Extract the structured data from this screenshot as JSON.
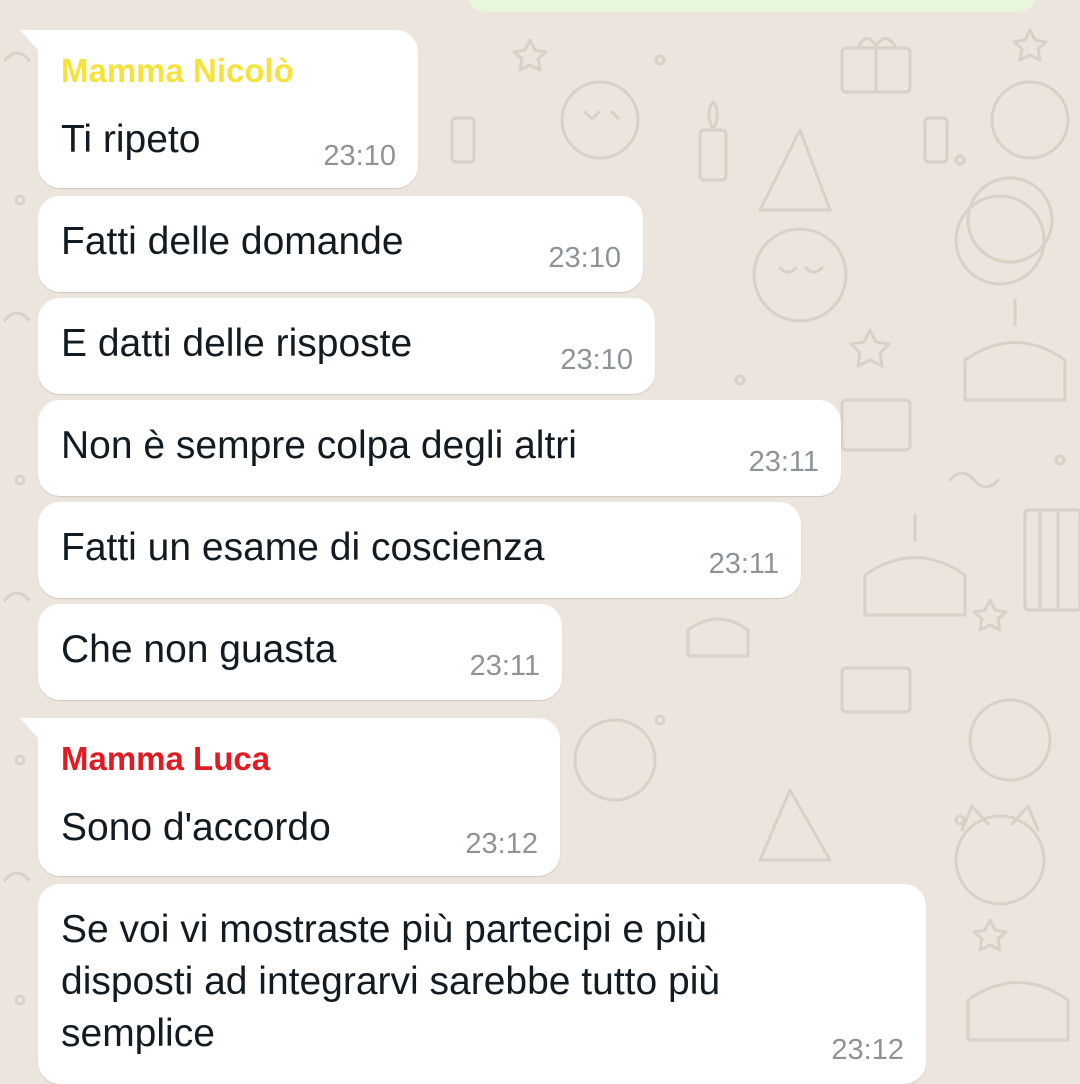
{
  "colors": {
    "background": "#ece5dd",
    "bubble_incoming": "#ffffff",
    "bubble_outgoing": "#e7f7dc",
    "sender_mamma_nicolo": "#f5e23c",
    "sender_mamma_luca": "#e11b22",
    "text": "#111b21",
    "timestamp": "#8c9499"
  },
  "messages": [
    {
      "sender": "Mamma Nicolò",
      "text": "Ti ripeto",
      "time": "23:10"
    },
    {
      "text": "Fatti delle domande",
      "time": "23:10"
    },
    {
      "text": "E datti delle risposte",
      "time": "23:10"
    },
    {
      "text": "Non è sempre colpa degli altri",
      "time": "23:11"
    },
    {
      "text": "Fatti un esame di coscienza",
      "time": "23:11"
    },
    {
      "text": "Che non guasta",
      "time": "23:11"
    },
    {
      "sender": "Mamma Luca",
      "text": "Sono d'accordo",
      "time": "23:12"
    },
    {
      "text": "Se voi vi mostraste più partecipi e più disposti ad integrarvi sarebbe tutto più semplice",
      "time": "23:12"
    }
  ]
}
